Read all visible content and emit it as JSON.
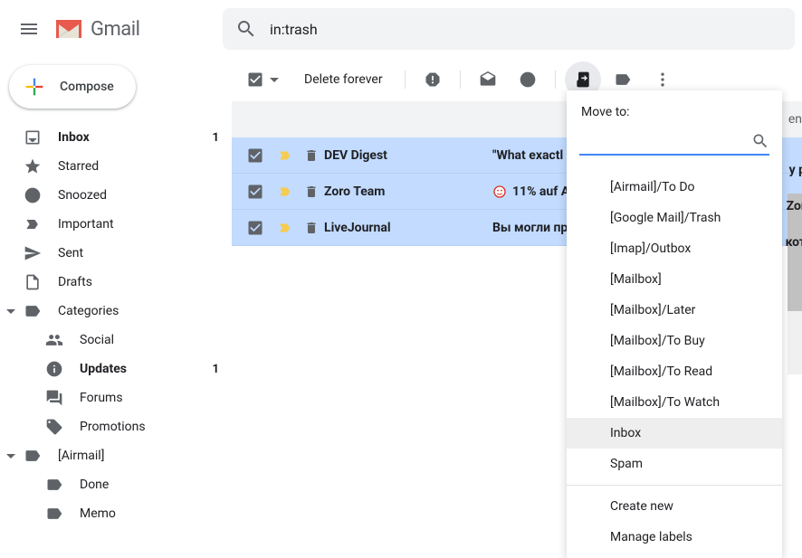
{
  "header": {
    "app_name": "Gmail",
    "search_value": "in:trash"
  },
  "compose_label": "Compose",
  "sidebar": {
    "items": [
      {
        "label": "Inbox",
        "count": "1",
        "bold": true,
        "icon": "inbox"
      },
      {
        "label": "Starred",
        "icon": "star"
      },
      {
        "label": "Snoozed",
        "icon": "clock"
      },
      {
        "label": "Important",
        "icon": "important"
      },
      {
        "label": "Sent",
        "icon": "send"
      },
      {
        "label": "Drafts",
        "icon": "file"
      },
      {
        "label": "Categories",
        "icon": "label",
        "expanded": true
      },
      {
        "label": "Social",
        "icon": "people",
        "indent": 2
      },
      {
        "label": "Updates",
        "count": "1",
        "bold": true,
        "icon": "info",
        "indent": 2
      },
      {
        "label": "Forums",
        "icon": "forum",
        "indent": 2
      },
      {
        "label": "Promotions",
        "icon": "tag",
        "indent": 2
      },
      {
        "label": "[Airmail]",
        "icon": "label",
        "expanded": true
      },
      {
        "label": "Done",
        "icon": "label",
        "indent": 2
      },
      {
        "label": "Memo",
        "icon": "label",
        "indent": 2
      }
    ]
  },
  "toolbar": {
    "delete_forever": "Delete forever"
  },
  "rows": [
    {
      "sender": "DEV Digest",
      "subject": "\"What exactl",
      "extra_right": "y p"
    },
    {
      "sender": "Zoro Team",
      "subject": "11% auf A",
      "badge": true,
      "extra_right": "Zor"
    },
    {
      "sender": "LiveJournal",
      "subject": "Вы могли пр",
      "extra_right": "кот"
    }
  ],
  "banner_right": "en",
  "popover": {
    "title": "Move to:",
    "search_value": "",
    "options": [
      "[Airmail]/To Do",
      "[Google Mail]/Trash",
      "[Imap]/Outbox",
      "[Mailbox]",
      "[Mailbox]/Later",
      "[Mailbox]/To Buy",
      "[Mailbox]/To Read",
      "[Mailbox]/To Watch",
      "Inbox",
      "Spam"
    ],
    "hovered_index": 8,
    "create_new": "Create new",
    "manage_labels": "Manage labels"
  }
}
